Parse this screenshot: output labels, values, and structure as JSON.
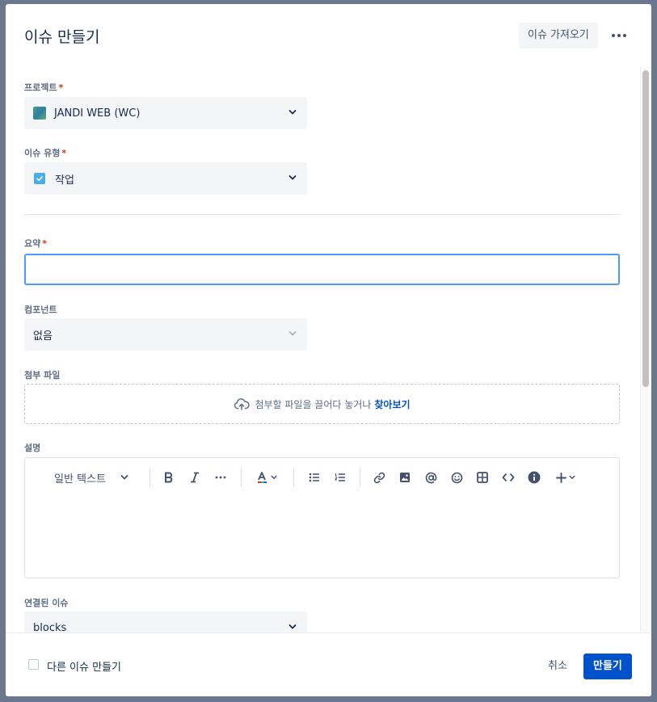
{
  "modal": {
    "title": "이슈 만들기",
    "import_label": "이슈 가져오기"
  },
  "fields": {
    "project": {
      "label": "프로젝트",
      "required": "*",
      "value": "JANDI WEB (WC)"
    },
    "issue_type": {
      "label": "이슈 유형",
      "required": "*",
      "value": "작업"
    },
    "summary": {
      "label": "요약",
      "required": "*",
      "value": ""
    },
    "component": {
      "label": "컴포넌트",
      "value": "없음"
    },
    "attachment": {
      "label": "첨부 파일",
      "drop_text": "첨부할 파일을 끌어다 놓거나",
      "browse_text": "찾아보기"
    },
    "description": {
      "label": "설명",
      "text_style": "일반 텍스트"
    },
    "linked_issues": {
      "label": "연결된 이슈",
      "value": "blocks"
    }
  },
  "footer": {
    "create_another_label": "다른 이슈 만들기",
    "cancel_label": "취소",
    "create_label": "만들기"
  },
  "colors": {
    "primary": "#0052cc",
    "focus_border": "#4c9aff",
    "required": "#de350b",
    "field_bg": "#f4f5f7",
    "backdrop": "#6b778c"
  }
}
